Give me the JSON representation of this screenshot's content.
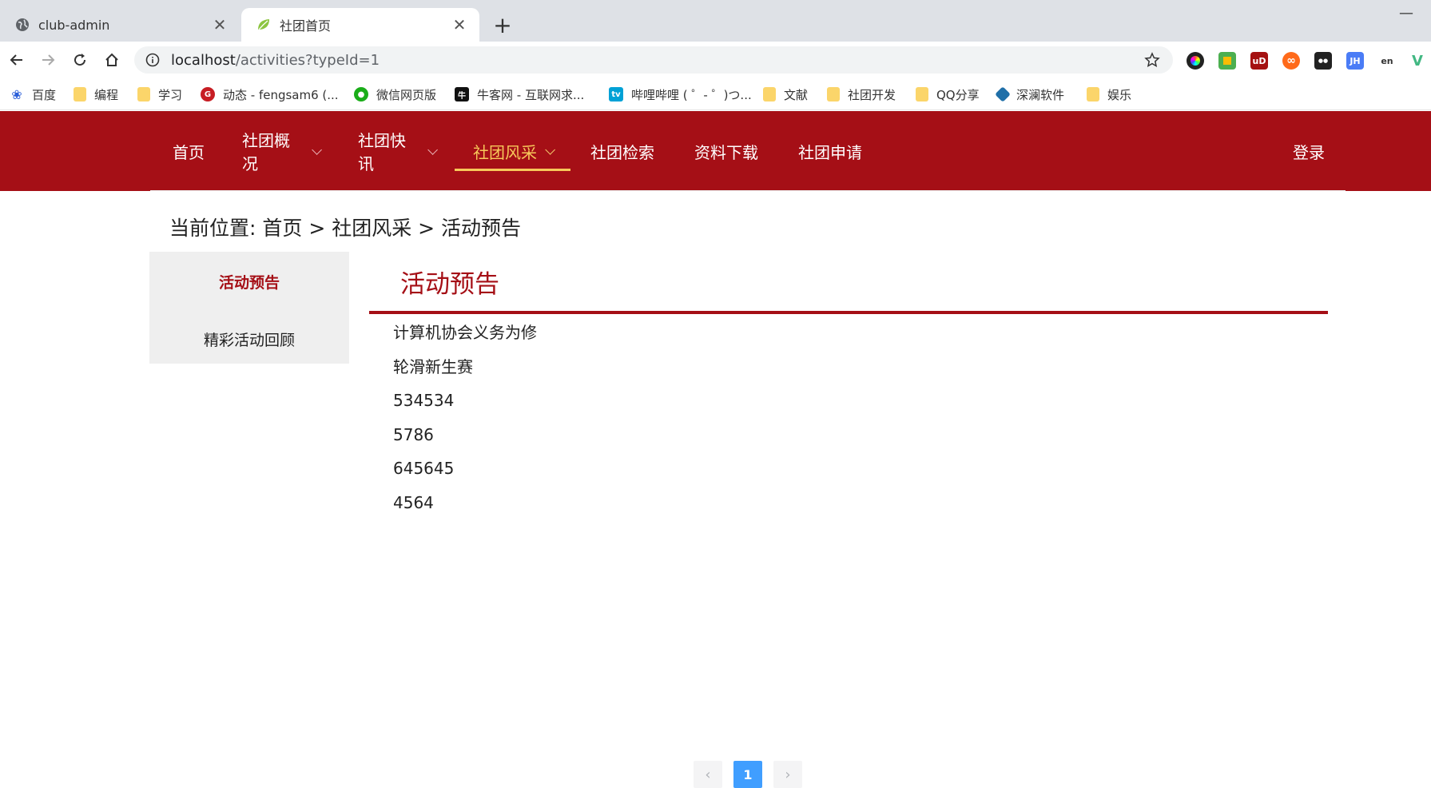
{
  "browser": {
    "tabs": [
      {
        "title": "club-admin",
        "icon": "globe-icon",
        "active": false
      },
      {
        "title": "社团首页",
        "icon": "leaf-icon",
        "active": true
      }
    ],
    "close_glyph": "✕",
    "new_tab_glyph": "+",
    "minimize_glyph": "—",
    "url_host": "localhost",
    "url_path": "/activities?typeId=1",
    "extensions": [
      {
        "name": "color-picker-extension",
        "label": "",
        "color": "#222222"
      },
      {
        "name": "google-extension",
        "label": "",
        "color": "#4caf50"
      },
      {
        "name": "ublock-extension",
        "label": "uD",
        "color": "#a51212"
      },
      {
        "name": "infinity-extension",
        "label": "∞",
        "color": "#ff6a1a"
      },
      {
        "name": "tampermonkey-extension",
        "label": "●●",
        "color": "#222222"
      },
      {
        "name": "jh-extension",
        "label": "JH",
        "color": "#4a7cf6"
      },
      {
        "name": "translate-extension",
        "label": "en",
        "color": "#ffffff"
      },
      {
        "name": "vue-devtools-extension",
        "label": "V",
        "color": "#42b883"
      }
    ],
    "bookmarks": [
      {
        "label": "百度",
        "icon": "baidu-icon"
      },
      {
        "label": "编程",
        "icon": "folder-icon"
      },
      {
        "label": "学习",
        "icon": "folder-icon"
      },
      {
        "label": "动态 - fengsam6 (...",
        "icon": "gitee-icon"
      },
      {
        "label": "微信网页版",
        "icon": "wechat-icon"
      },
      {
        "label": "牛客网 - 互联网求...",
        "icon": "nowcoder-icon"
      },
      {
        "label": "哔哩哔哩 ( ゜- ゜)つ...",
        "icon": "bilibili-icon"
      },
      {
        "label": "文献",
        "icon": "folder-icon"
      },
      {
        "label": "社团开发",
        "icon": "folder-icon"
      },
      {
        "label": "QQ分享",
        "icon": "folder-icon"
      },
      {
        "label": "深澜软件",
        "icon": "srun-icon"
      },
      {
        "label": "娱乐",
        "icon": "folder-icon"
      }
    ]
  },
  "site": {
    "nav": [
      {
        "label": "首页",
        "dropdown": false,
        "active": false
      },
      {
        "label": "社团概况",
        "dropdown": true,
        "active": false
      },
      {
        "label": "社团快讯",
        "dropdown": true,
        "active": false
      },
      {
        "label": "社团风采",
        "dropdown": true,
        "active": true
      },
      {
        "label": "社团检索",
        "dropdown": false,
        "active": false
      },
      {
        "label": "资料下载",
        "dropdown": false,
        "active": false
      },
      {
        "label": "社团申请",
        "dropdown": false,
        "active": false
      }
    ],
    "login": "登录",
    "breadcrumb": "当前位置: 首页 > 社团风采 > 活动预告",
    "sidebar": [
      "活动预告",
      "精彩活动回顾"
    ],
    "content_title": "活动预告",
    "items": [
      "计算机协会义务为修",
      "轮滑新生赛",
      "534534",
      "5786",
      "645645",
      "4564"
    ],
    "pagination": {
      "prev": "‹",
      "current": "1",
      "next": "›"
    },
    "colors": {
      "brand": "#a50f16",
      "active_nav": "#f7c85a",
      "pager_active": "#409eff"
    }
  }
}
